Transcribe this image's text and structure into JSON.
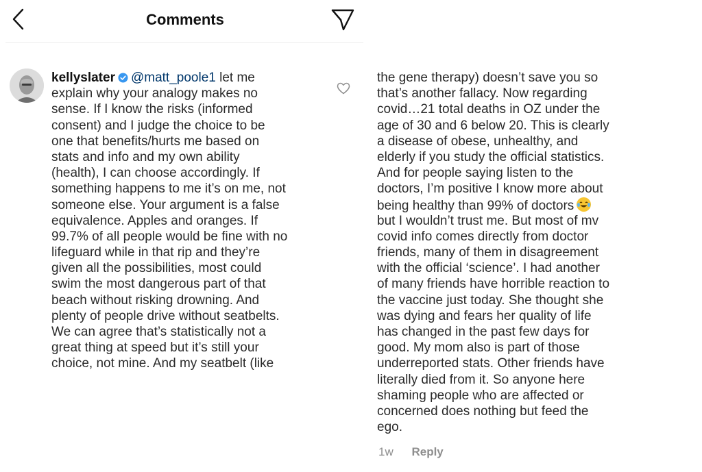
{
  "header": {
    "title": "Comments",
    "back_icon": "chevron-left-icon",
    "send_icon": "paper-plane-icon"
  },
  "comment": {
    "username": "kellyslater",
    "mention": "@matt_poole1",
    "verified_color": "#3897f0",
    "mention_color": "#00376b",
    "left_lines": [
      " let me",
      "explain why your analogy makes no",
      "sense. If I know the risks (informed",
      "consent) and I judge the choice to be",
      "one that benefits/hurts me based on",
      "stats and info and my own ability",
      "(health), I can choose accordingly. If",
      "something happens to me it’s on me, not",
      "someone else. Your argument is a false",
      "equivalence. Apples and oranges. If",
      "99.7% of all people would be fine with no",
      "lifeguard while in that rip and they’re",
      "given all the possibilities, most could",
      "swim the most dangerous part of that",
      "beach without risking drowning. And",
      "plenty of people drive without seatbelts.",
      "We can agree that’s statistically not a",
      "great thing at speed but it’s still your",
      "choice, not mine. And my seatbelt (like"
    ],
    "right_lines": [
      "the gene therapy) doesn’t save you so",
      "that’s another fallacy. Now regarding",
      "covid…21 total deaths in OZ under the",
      "age of 30 and 6 below 20. This is clearly",
      "a disease of obese, unhealthy, and",
      "elderly if you study the official statistics.",
      "And for people saying listen to the",
      "doctors, I’m positive I know more about",
      "being healthy than 99% of doctors",
      "but I wouldn’t trust me. But most of mv",
      "covid info comes directly from doctor",
      "friends, many of them in disagreement",
      "with the official ‘science’. I had another",
      "of many friends have horrible reaction to",
      "the vaccine just today. She thought she",
      "was dying and fears her quality of life",
      "has changed in the past few days for",
      "good. My mom also is part of those",
      "underreported stats. Other friends have",
      "literally died from it. So anyone here",
      "shaming people who are affected or",
      "concerned does nothing but feed the",
      "ego."
    ],
    "emoji_icon": "laughing-tears-emoji-icon",
    "timestamp": "1w",
    "reply_label": "Reply",
    "like_icon": "heart-outline-icon"
  }
}
